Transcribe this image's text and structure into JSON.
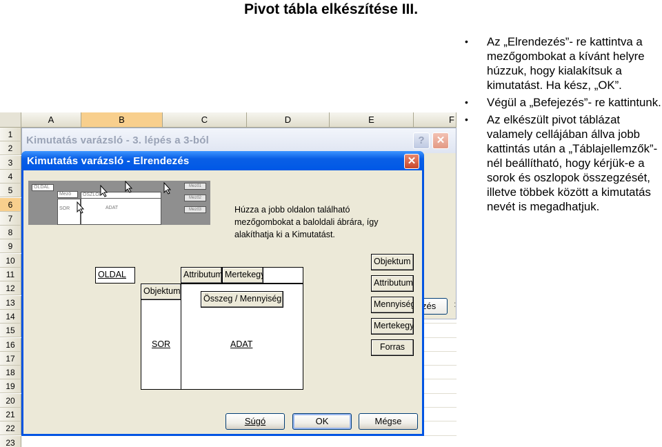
{
  "slide": {
    "title": "Pivot tábla elkészítése III."
  },
  "sheet": {
    "columns": [
      "A",
      "B",
      "C",
      "D",
      "E",
      "F"
    ],
    "rows": [
      "1",
      "2",
      "3",
      "4",
      "5",
      "6",
      "7",
      "8",
      "9",
      "10",
      "11",
      "12",
      "13",
      "14",
      "15",
      "16",
      "17",
      "18",
      "19",
      "20",
      "21",
      "22",
      "23"
    ],
    "selected_column": "B",
    "selected_row": "6"
  },
  "dialog_step3": {
    "title": "Kimutatás varázsló - 3. lépés a 3-ból",
    "help_label": "?",
    "close_label": "✕",
    "partial_button": "zés",
    "partial_text": ":"
  },
  "dialog_layout": {
    "title": "Kimutatás varázsló - Elrendezés",
    "close_label": "✕",
    "instruction_lines": [
      "Húzza a jobb oldalon található",
      "mezőgombokat a baloldali ábrára, így",
      "alakíthatja ki a Kimutatást."
    ],
    "mini": {
      "oldal": "OLDAL",
      "oszlop": "OSZLOP",
      "sor": "SOR",
      "adat": "ADAT",
      "mezo1": "Mező1",
      "mezo2": "Mező2",
      "mezo3": "Mező3",
      "sample1": "Mező",
      "sample2": "Mező"
    },
    "page_area": {
      "label": "OLDAL"
    },
    "column_fields": [
      "Attributum",
      "Mertekegys"
    ],
    "row_fields": [
      "Objektum"
    ],
    "data_field": "Összeg / Mennyiség",
    "row_area_label": "SOR",
    "data_area_label": "ADAT",
    "field_buttons": [
      "Objektum",
      "Attributum",
      "Mennyiség",
      "Mertekegys",
      "Forras"
    ],
    "buttons": {
      "help": "Súgó",
      "ok": "OK",
      "cancel": "Mégse"
    }
  },
  "bullets": [
    "Az „Elrendezés”- re kattintva a mezőgombokat a kívánt helyre húzzuk, hogy kialakítsuk a kimutatást. Ha kész, „OK”.",
    "Végül a „Befejezés”- re kattintunk.",
    "Az elkészült pivot táblázat valamely cellájában állva jobb kattintás után a „Táblajellemzők”-nél beállítható, hogy kérjük-e a sorok és oszlopok összegzését, illetve többek között a kimutatás nevét is megadhatjuk."
  ]
}
